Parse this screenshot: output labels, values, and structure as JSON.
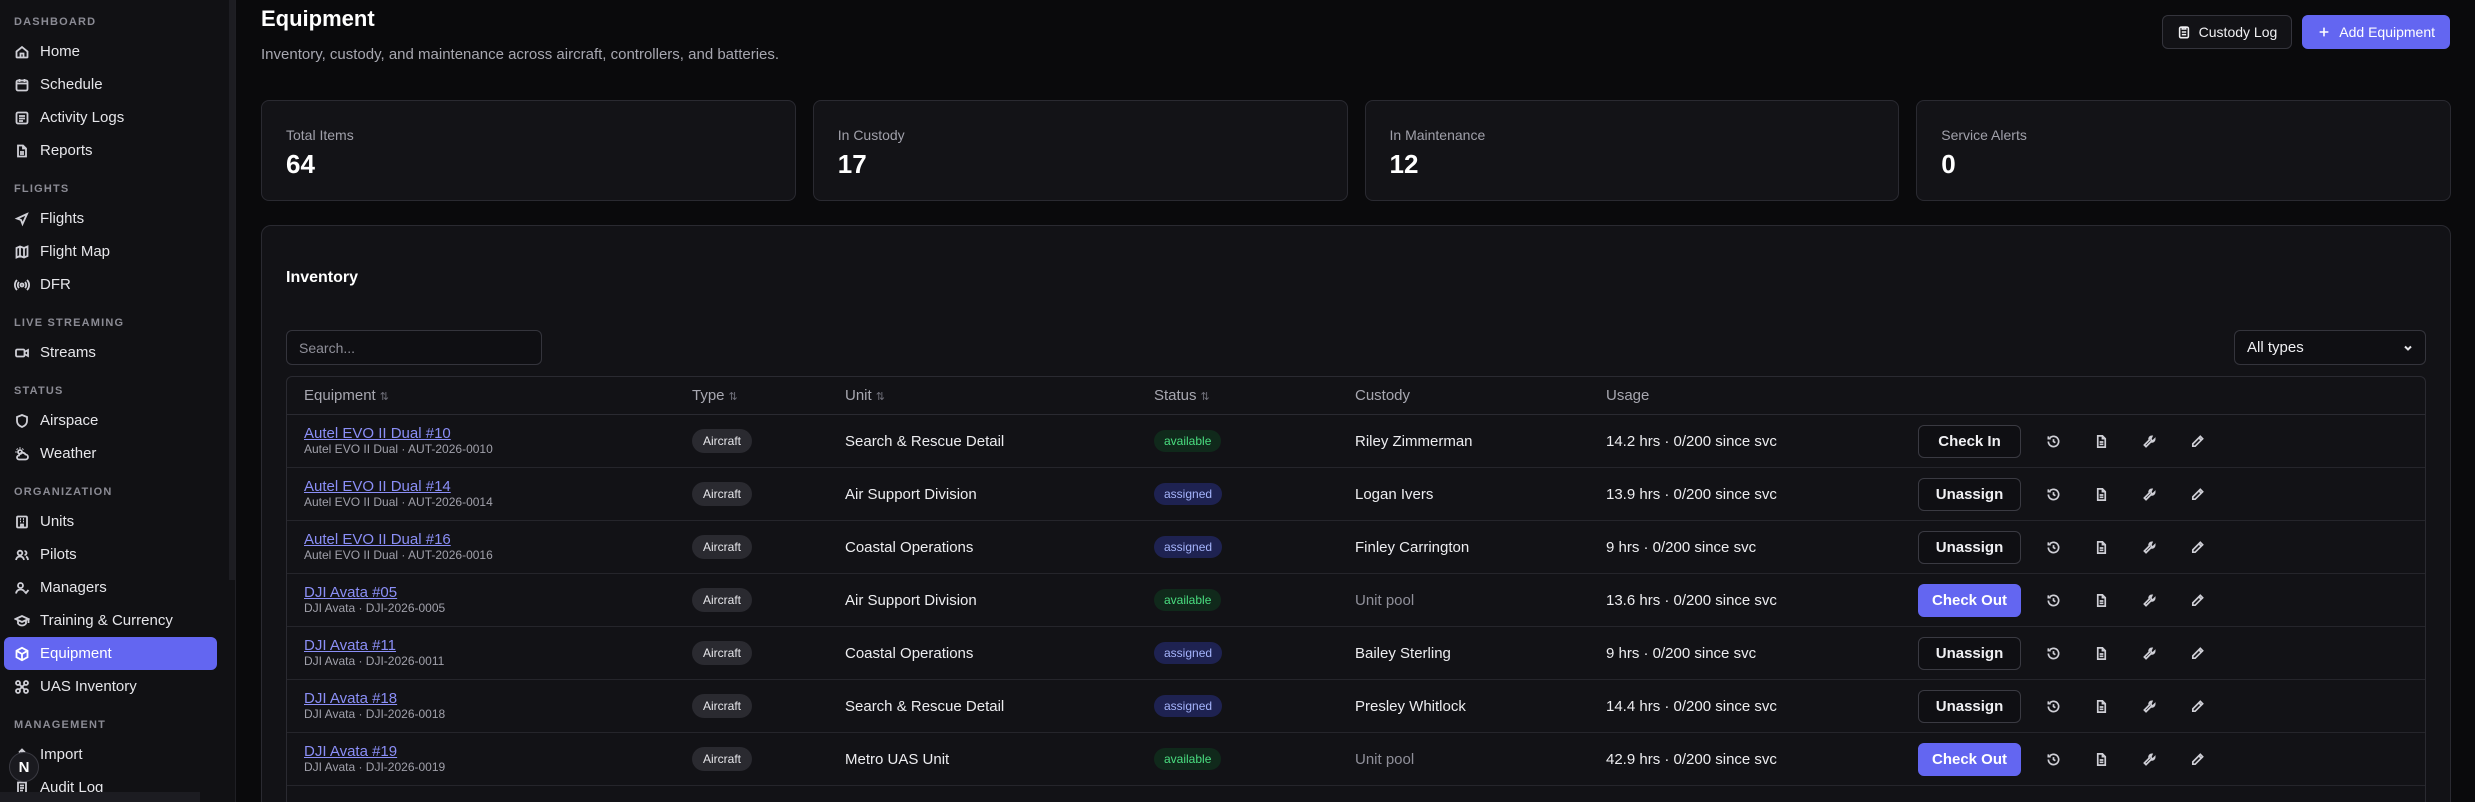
{
  "sidebar": {
    "sections": [
      {
        "label": "DASHBOARD",
        "items": [
          "Home",
          "Schedule",
          "Activity Logs",
          "Reports"
        ]
      },
      {
        "label": "FLIGHTS",
        "items": [
          "Flights",
          "Flight Map",
          "DFR"
        ]
      },
      {
        "label": "LIVE STREAMING",
        "items": [
          "Streams"
        ]
      },
      {
        "label": "STATUS",
        "items": [
          "Airspace",
          "Weather"
        ]
      },
      {
        "label": "ORGANIZATION",
        "items": [
          "Units",
          "Pilots",
          "Managers",
          "Training & Currency",
          "Equipment",
          "UAS Inventory"
        ]
      },
      {
        "label": "MANAGEMENT",
        "items": [
          "Import",
          "Audit Log"
        ]
      }
    ],
    "avatar_initial": "N",
    "active_item": "Equipment"
  },
  "header": {
    "title": "Equipment",
    "subtitle": "Inventory, custody, and maintenance across aircraft, controllers, and batteries.",
    "custody_log_label": "Custody Log",
    "add_equipment_label": "Add Equipment"
  },
  "stats": [
    {
      "label": "Total Items",
      "value": "64"
    },
    {
      "label": "In Custody",
      "value": "17"
    },
    {
      "label": "In Maintenance",
      "value": "12"
    },
    {
      "label": "Service Alerts",
      "value": "0"
    }
  ],
  "inventory": {
    "title": "Inventory",
    "search_placeholder": "Search...",
    "type_filter": "All types",
    "columns": [
      "Equipment",
      "Type",
      "Unit",
      "Status",
      "Custody",
      "Usage"
    ],
    "rows": [
      {
        "name": "Autel EVO II Dual #10",
        "sub": "Autel EVO II Dual · AUT-2026-0010",
        "type": "Aircraft",
        "unit": "Search & Rescue Detail",
        "status": "available",
        "custody": "Riley Zimmerman",
        "usage": "14.2 hrs · 0/200 since svc",
        "action": "Check In"
      },
      {
        "name": "Autel EVO II Dual #14",
        "sub": "Autel EVO II Dual · AUT-2026-0014",
        "type": "Aircraft",
        "unit": "Air Support Division",
        "status": "assigned",
        "custody": "Logan Ivers",
        "usage": "13.9 hrs · 0/200 since svc",
        "action": "Unassign"
      },
      {
        "name": "Autel EVO II Dual #16",
        "sub": "Autel EVO II Dual · AUT-2026-0016",
        "type": "Aircraft",
        "unit": "Coastal Operations",
        "status": "assigned",
        "custody": "Finley Carrington",
        "usage": "9 hrs · 0/200 since svc",
        "action": "Unassign"
      },
      {
        "name": "DJI Avata #05",
        "sub": "DJI Avata · DJI-2026-0005",
        "type": "Aircraft",
        "unit": "Air Support Division",
        "status": "available",
        "custody": "Unit pool",
        "usage": "13.6 hrs · 0/200 since svc",
        "action": "Check Out"
      },
      {
        "name": "DJI Avata #11",
        "sub": "DJI Avata · DJI-2026-0011",
        "type": "Aircraft",
        "unit": "Coastal Operations",
        "status": "assigned",
        "custody": "Bailey Sterling",
        "usage": "9 hrs · 0/200 since svc",
        "action": "Unassign"
      },
      {
        "name": "DJI Avata #18",
        "sub": "DJI Avata · DJI-2026-0018",
        "type": "Aircraft",
        "unit": "Search & Rescue Detail",
        "status": "assigned",
        "custody": "Presley Whitlock",
        "usage": "14.4 hrs · 0/200 since svc",
        "action": "Unassign"
      },
      {
        "name": "DJI Avata #19",
        "sub": "DJI Avata · DJI-2026-0019",
        "type": "Aircraft",
        "unit": "Metro UAS Unit",
        "status": "available",
        "custody": "Unit pool",
        "usage": "42.9 hrs · 0/200 since svc",
        "action": "Check Out"
      }
    ]
  },
  "colors": {
    "accent": "#6366f1",
    "available": "#4ade80",
    "assigned": "#a5b4fc",
    "link": "#8b8ff7"
  }
}
